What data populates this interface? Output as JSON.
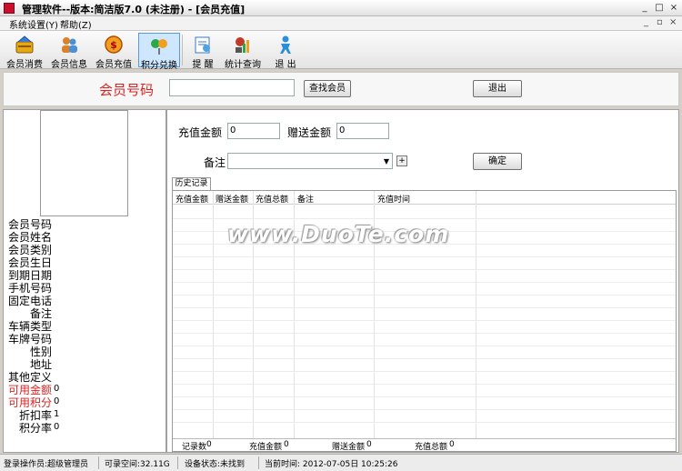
{
  "window": {
    "title": "管理软件--版本:简洁版7.0 (未注册) - [会员充值]",
    "controls": {
      "minimize": "_",
      "maximize": "□",
      "close": "×"
    }
  },
  "menubar": {
    "items": [
      "系统设置(Y)",
      "帮助(Z)"
    ],
    "mdi_controls": [
      "_",
      "▫",
      "×"
    ]
  },
  "toolbar": {
    "items": [
      {
        "label": "会员消费",
        "icon": "card-icon"
      },
      {
        "label": "会员信息",
        "icon": "users-icon"
      },
      {
        "label": "会员充值",
        "icon": "coin-icon"
      },
      {
        "label": "积分兑换",
        "icon": "exchange-icon",
        "active": true
      },
      {
        "label": "提 醒",
        "icon": "reminder-icon"
      },
      {
        "label": "统计查询",
        "icon": "stats-icon"
      },
      {
        "label": "退 出",
        "icon": "exit-icon"
      }
    ]
  },
  "search": {
    "label": "会员号码",
    "value": "",
    "find_button": "查找会员",
    "exit_button": "退出"
  },
  "member_fields": [
    {
      "label": "会员号码",
      "value": ""
    },
    {
      "label": "会员姓名",
      "value": ""
    },
    {
      "label": "会员类别",
      "value": ""
    },
    {
      "label": "会员生日",
      "value": ""
    },
    {
      "label": "到期日期",
      "value": ""
    },
    {
      "label": "手机号码",
      "value": ""
    },
    {
      "label": "固定电话",
      "value": ""
    },
    {
      "label": "备注",
      "value": ""
    },
    {
      "label": "车辆类型",
      "value": ""
    },
    {
      "label": "车牌号码",
      "value": ""
    },
    {
      "label": "性别",
      "value": ""
    },
    {
      "label": "地址",
      "value": ""
    },
    {
      "label": "其他定义",
      "value": ""
    },
    {
      "label": "可用金额",
      "value": "0",
      "red": true
    },
    {
      "label": "可用积分",
      "value": "0",
      "red": true
    },
    {
      "label": "折扣率",
      "value": "1"
    },
    {
      "label": "积分率",
      "value": "0"
    }
  ],
  "recharge": {
    "amount_label": "充值金额",
    "amount_value": "0",
    "bonus_label": "赠送金额",
    "bonus_value": "0",
    "note_label": "备注",
    "note_value": "",
    "add_button": "+",
    "confirm_button": "确定"
  },
  "history": {
    "tab": "历史记录",
    "columns": [
      "充值金额",
      "赠送金额",
      "充值总额",
      "备注",
      "充值时间"
    ],
    "rows": [],
    "footer": [
      {
        "label": "记录数",
        "value": "0"
      },
      {
        "label": "充值金额",
        "value": "0"
      },
      {
        "label": "赠送金额",
        "value": "0"
      },
      {
        "label": "充值总额",
        "value": "0"
      }
    ]
  },
  "statusbar": {
    "operator": "登录操作员:超级管理员",
    "space": "可录空间:32.11G",
    "device": "设备状态:未找到",
    "time": "当前时间: 2012-07-05日  10:25:26"
  },
  "watermark": "www.DuoTe.com"
}
